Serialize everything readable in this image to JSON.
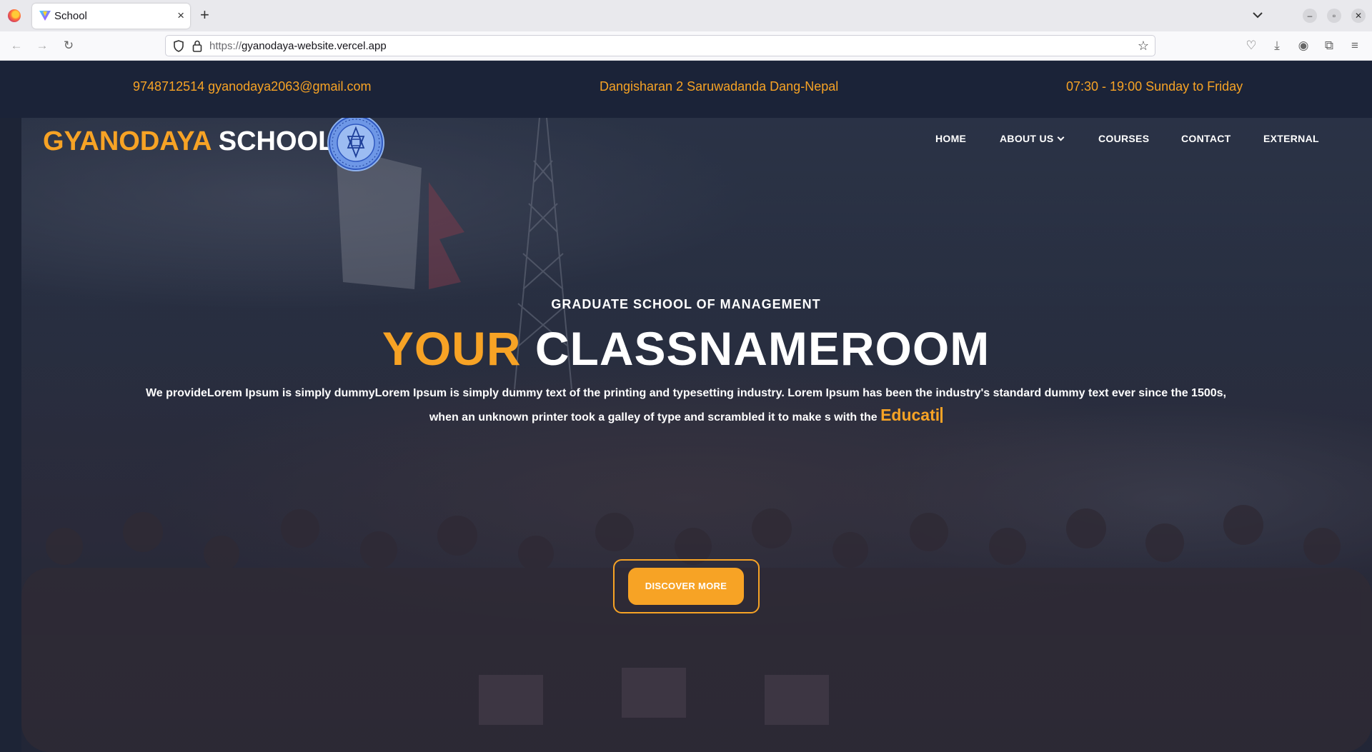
{
  "browser": {
    "tab_title": "School",
    "new_tab_symbol": "+",
    "close_symbol": "×",
    "url_scheme": "https://",
    "url_host": "gyanodaya-website.vercel.app",
    "icons": [
      "firefox-logo-icon",
      "back-icon",
      "forward-icon",
      "reload-icon",
      "shield-icon",
      "lock-icon",
      "bookmark-star-icon",
      "pocket-icon",
      "download-icon",
      "account-icon",
      "extensions-icon",
      "menu-icon",
      "tab-list-icon",
      "minimize-icon",
      "restore-icon",
      "close-icon"
    ]
  },
  "topbar": {
    "contact": "9748712514 gyanodaya2063@gmail.com",
    "address": "Dangisharan 2 Saruwadanda Dang-Nepal",
    "hours": "07:30 - 19:00 Sunday to Friday"
  },
  "header": {
    "brand_part1": "GYANODAYA",
    "brand_part2": "SCHOOL",
    "nav": {
      "home": "HOME",
      "about": "ABOUT US",
      "courses": "COURSES",
      "contact": "CONTACT",
      "external": "EXTERNAL"
    }
  },
  "hero": {
    "subtitle": "GRADUATE SCHOOL OF MANAGEMENT",
    "headline_part1": "YOUR",
    "headline_part2": "CLASSNAMEROOM",
    "description": "We provideLorem Ipsum is simply dummyLorem Ipsum is simply dummy text of the printing and typesetting industry. Lorem Ipsum has been the industry's standard dummy text ever since the 1500s, when an unknown printer took a galley of type and scrambled it to make s with the",
    "typed_word": "Educati",
    "cta": "DISCOVER MORE"
  },
  "colors": {
    "accent": "#f7a325",
    "dark_navy": "#1b2338"
  }
}
